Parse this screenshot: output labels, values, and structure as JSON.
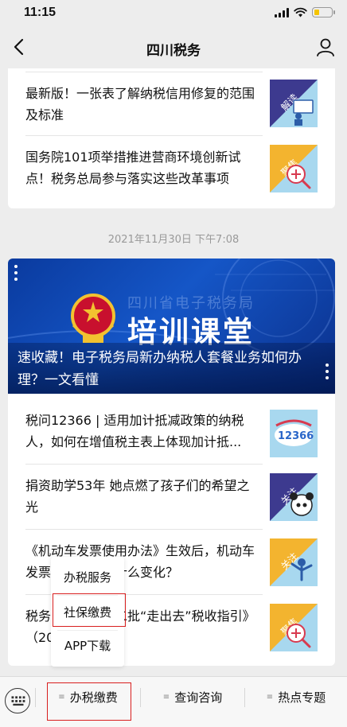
{
  "status_bar": {
    "time": "11:15"
  },
  "nav": {
    "title": "四川税务"
  },
  "top_articles": [
    {
      "title": "最新版！一张表了解纳税信用修复的范围及标准",
      "thumb_label": "解读",
      "thumb_color": "#4a3f99"
    },
    {
      "title": "国务院101项举措推进营商环境创新试点！税务总局参与落实这些改革事项",
      "thumb_label": "聚焦",
      "thumb_color": "#f3b42f"
    }
  ],
  "timestamp": "2021年11月30日 下午7:08",
  "banner": {
    "watermark": "四川省电子税务局",
    "headline": "培训课堂",
    "title": "速收藏！电子税务局新办纳税人套餐业务如何办理？一文看懂"
  },
  "articles": [
    {
      "title": "税问12366 | 适用加计抵减政策的纳税人，如何在增值税主表上体现加计抵...",
      "thumb_label": "12366"
    },
    {
      "title": "捐资助学53年 她点燃了孩子们的希望之光",
      "thumb_label": "关注"
    },
    {
      "title": "《机动车发票使用办法》生效后，机动车发票开具方式有什么变化？",
      "thumb_label": "关注"
    },
    {
      "title": "税务总局发布第二批“走出去”税收指引》（2021年）",
      "thumb_label": "聚焦"
    }
  ],
  "popup_menu": {
    "items": [
      "办税服务",
      "社保缴费",
      "APP下载"
    ]
  },
  "tab_bar": {
    "tabs": [
      "办税缴费",
      "查询咨询",
      "热点专题"
    ]
  },
  "colors": {
    "accent_red": "#d81e1e",
    "banner_blue": "#1556c7"
  }
}
